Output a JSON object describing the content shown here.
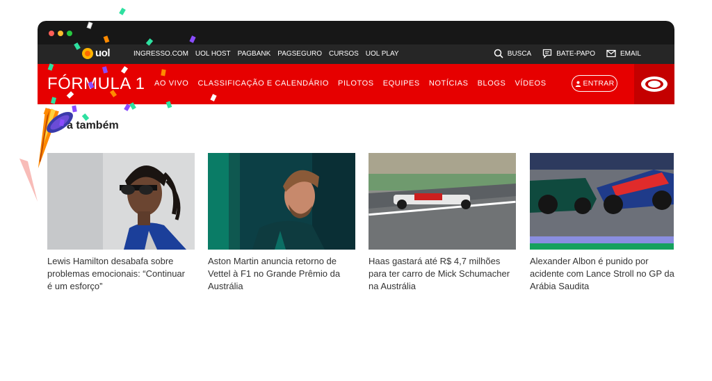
{
  "uol_bar": {
    "logo": "uol",
    "links": [
      "INGRESSO.COM",
      "UOL HOST",
      "PAGBANK",
      "PAGSEGURO",
      "CURSOS",
      "UOL PLAY"
    ],
    "right": [
      {
        "label": "BUSCA",
        "icon": "search-icon"
      },
      {
        "label": "BATE-PAPO",
        "icon": "chat-icon"
      },
      {
        "label": "EMAIL",
        "icon": "email-icon"
      }
    ]
  },
  "f1_bar": {
    "title": "FÓRMULA 1",
    "nav": [
      "AO VIVO",
      "CLASSIFICAÇÃO E CALENDÁRIO",
      "PILOTOS",
      "EQUIPES",
      "NOTÍCIAS",
      "BLOGS",
      "VÍDEOS"
    ],
    "login_label": "ENTRAR",
    "brand_icon": "band-eye-icon"
  },
  "section": {
    "title": "a também"
  },
  "cards": [
    {
      "caption": "Lewis Hamilton desabafa sobre problemas emocionais: “Continuar é um esforço”"
    },
    {
      "caption": "Aston Martin anuncia retorno de Vettel à F1 no Grande Prêmio da Austrália"
    },
    {
      "caption": "Haas gastará até R$ 4,7 milhões para ter carro de Mick Schumacher na Austrália"
    },
    {
      "caption": "Alexander Albon é punido por acidente com Lance Stroll no GP da Arábia Saudita"
    }
  ],
  "colors": {
    "f1_red": "#e60000",
    "uol_bar": "#262626",
    "titlebar": "#171717"
  }
}
